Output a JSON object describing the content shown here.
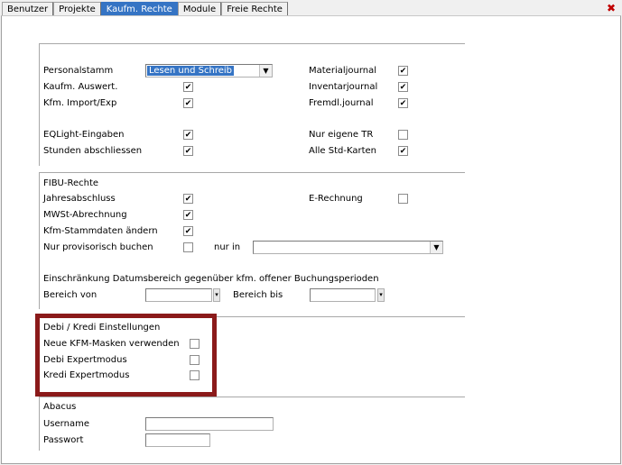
{
  "tabs": [
    {
      "label": "Benutzer"
    },
    {
      "label": "Projekte"
    },
    {
      "label": "Kaufm. Rechte"
    },
    {
      "label": "Module"
    },
    {
      "label": "Freie Rechte"
    }
  ],
  "close_glyph": "✖",
  "section1": {
    "personalstamm_label": "Personalstamm",
    "personalstamm_value": "Lesen und Schreib",
    "kaufm_auswert_label": "Kaufm. Auswert.",
    "kfm_import_label": "Kfm. Import/Exp",
    "eqlight_label": "EQLight-Eingaben",
    "stunden_label": "Stunden abschliessen",
    "materialjournal_label": "Materialjournal",
    "inventarjournal_label": "Inventarjournal",
    "fremdl_label": "Fremdl.journal",
    "nur_eigene_label": "Nur eigene TR",
    "alle_std_label": "Alle Std-Karten"
  },
  "fibu": {
    "title": "FIBU-Rechte",
    "jahresabschluss_label": "Jahresabschluss",
    "mwst_label": "MWSt-Abrechnung",
    "stammdaten_label": "Kfm-Stammdaten ändern",
    "provisorisch_label": "Nur provisorisch buchen",
    "nur_in_label": "nur in",
    "erechnung_label": "E-Rechnung",
    "einschraenkung_label": "Einschränkung Datumsbereich gegenüber kfm. offener Buchungsperioden",
    "bereich_von_label": "Bereich von",
    "bereich_bis_label": "Bereich bis"
  },
  "debi": {
    "title": "Debi / Kredi Einstellungen",
    "neue_kfm_label": "Neue KFM-Masken verwenden",
    "debi_expert_label": "Debi Expertmodus",
    "kredi_expert_label": "Kredi Expertmodus"
  },
  "abacus": {
    "title": "Abacus",
    "username_label": "Username",
    "passwort_label": "Passwort"
  },
  "checkboxes": {
    "kaufm_auswert": true,
    "kfm_import": true,
    "eqlight": true,
    "stunden": true,
    "materialjournal": true,
    "inventarjournal": true,
    "fremdl": true,
    "nur_eigene": false,
    "alle_std": true,
    "jahresabschluss": true,
    "mwst": true,
    "stammdaten": true,
    "provisorisch": false,
    "erechnung": false,
    "neue_kfm": false,
    "debi_expert": false,
    "kredi_expert": false
  },
  "colors": {
    "active_tab": "#3574c4",
    "highlight_frame": "#8b1a1a"
  }
}
